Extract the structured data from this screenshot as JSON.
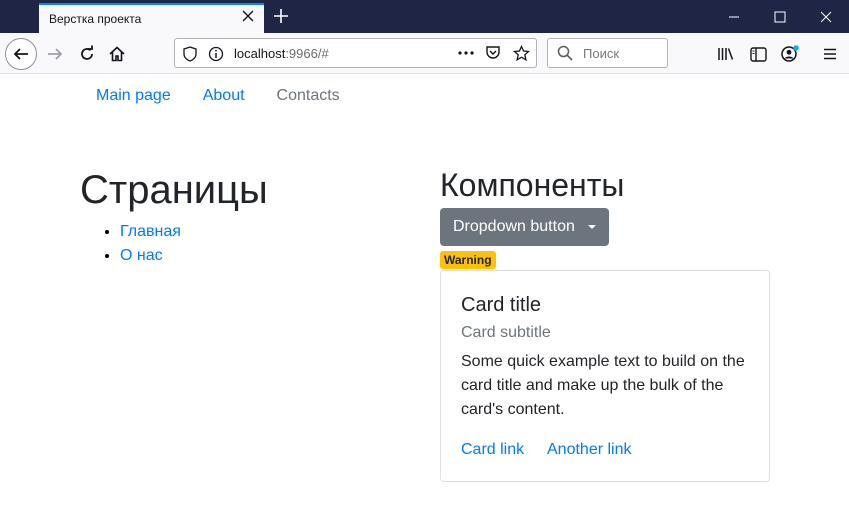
{
  "browser": {
    "tab_title": "Верстка проекта",
    "url_host": "localhost",
    "url_rest": ":9966/#",
    "search_placeholder": "Поиск"
  },
  "nav": {
    "main_page": "Main page",
    "about": "About",
    "contacts": "Contacts"
  },
  "pages": {
    "heading": "Страницы",
    "items": [
      "Главная",
      "О нас"
    ]
  },
  "components": {
    "heading": "Компоненты",
    "dropdown_label": "Dropdown button",
    "badge": "Warning",
    "card": {
      "title": "Card title",
      "subtitle": "Card subtitle",
      "text": "Some quick example text to build on the card title and make up the bulk of the card's content.",
      "link1": "Card link",
      "link2": "Another link"
    }
  },
  "colors": {
    "primary": "#007bff",
    "secondary": "#6c757d",
    "warning": "#ffc107",
    "titlebar": "#1f2544"
  }
}
